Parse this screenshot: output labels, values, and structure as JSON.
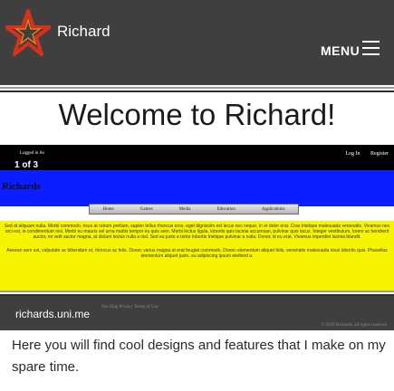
{
  "header": {
    "site_title": "Richard",
    "menu_label": "MENU",
    "logo_icon": "star-logo-icon",
    "menu_icon": "hamburger-menu-icon"
  },
  "welcome": {
    "heading": "Welcome to Richard!"
  },
  "embedded_site": {
    "logged_in_label": "Logged in As",
    "pager": "1 of 3",
    "auth_links": {
      "login": "Log In",
      "register": "Register"
    },
    "brand": "Richards",
    "nav": [
      "Home",
      "Games",
      "Media",
      "Education",
      "Applications"
    ],
    "paragraphs": [
      "Sed at aliquam nulla. Morbi commodo, risus at rutrum pretium, sapien tellus rhoncus eros, eget dignissim est lacus nec neque. In et dolor erat. Cras tristique malesuada venenatis. Vivamus nec orci est, in condimentum nisi. Morbi eu mauris vel urna mattis tempor eu quis sem. Morbi lectus ligula, lobortis quis lacinia accumsan, pulvinar quis lacus. Integer vestibulum, lorem ac hendrerit auctor, mi velit auctor magna, at dictum lectus nulla a nisl. Sed eu justo a tortor lobortis tristique pulvinar a nulla. Donec id eu erat. Vivamus imperdiet lacinia blandit.",
      "Aenean sem est, vulputate ac bibendum et, rhoncus ac felis. Donec varius magna at erat feugiat commodo. Donec elementum aliquet felis, venenatis malesuada risus lobortis quis. Phasellus elementum aliquet justo, eu adipiscing ipsum eleifend a."
    ],
    "footer_links": "Site Map  Privacy  Terms of Use",
    "copyright": "© 2018 Richards, all rights reserved"
  },
  "footer": {
    "domain": "richards.uni.me",
    "description": "Here you will find cool designs and features that I make on my spare time."
  },
  "colors": {
    "header_bg": "#3f3f3f",
    "embed_blue": "#0c1dff",
    "embed_yellow": "#f7f400",
    "logo_red": "#d6321b"
  }
}
